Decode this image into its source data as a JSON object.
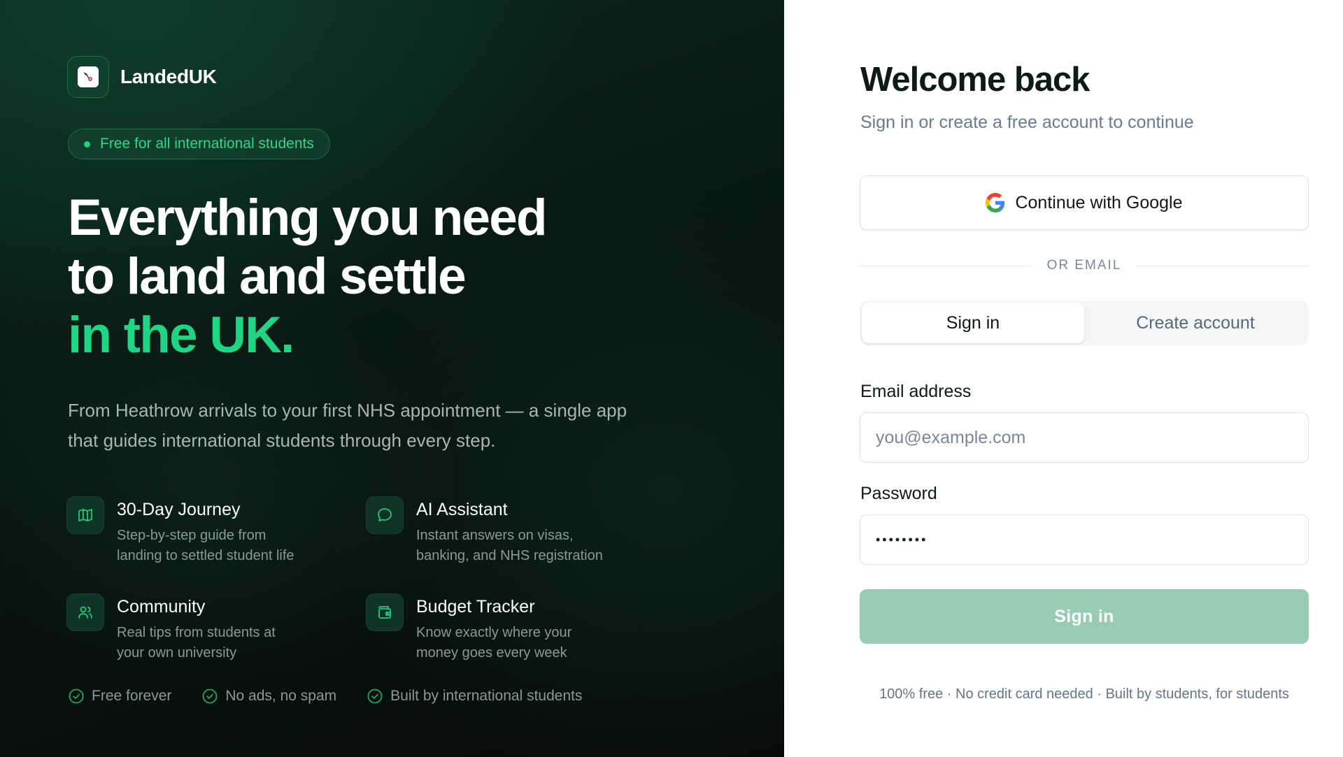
{
  "brand": {
    "name": "LandedUK",
    "icon": "landeduk-logo-icon"
  },
  "hero": {
    "badge": "Free for all international students",
    "headline_line1": "Everything you need",
    "headline_line2": "to land and settle",
    "headline_accent": "in the UK.",
    "lead": "From Heathrow arrivals to your first NHS appointment — a single app that guides international students through every step.",
    "features": [
      {
        "icon": "map-icon",
        "title": "30-Day Journey",
        "desc_line1": "Step-by-step guide from",
        "desc_line2": "landing to settled student life"
      },
      {
        "icon": "chat-bubble-icon",
        "title": "AI Assistant",
        "desc_line1": "Instant answers on visas,",
        "desc_line2": "banking, and NHS registration"
      },
      {
        "icon": "users-icon",
        "title": "Community",
        "desc_line1": "Real tips from students at",
        "desc_line2": "your own university"
      },
      {
        "icon": "wallet-icon",
        "title": "Budget Tracker",
        "desc_line1": "Know exactly where your",
        "desc_line2": "money goes every week"
      }
    ],
    "checks": [
      "Free forever",
      "No ads, no spam",
      "Built by international students"
    ]
  },
  "auth": {
    "title": "Welcome back",
    "subtitle": "Sign in or create a free account to continue",
    "google_label": "Continue with Google",
    "divider": "OR EMAIL",
    "tabs": [
      {
        "label": "Sign in",
        "active": true
      },
      {
        "label": "Create account",
        "active": false
      }
    ],
    "email_label": "Email address",
    "email_placeholder": "you@example.com",
    "email_value": "",
    "password_label": "Password",
    "password_value": "••••••••",
    "submit_label": "Sign in",
    "footnote": "100% free · No credit card needed · Built by students, for students"
  },
  "colors": {
    "accent": "#1fd483",
    "hero_bg": "#08140f",
    "submit_bg": "#97cbb2",
    "title": "#0e1a14"
  }
}
